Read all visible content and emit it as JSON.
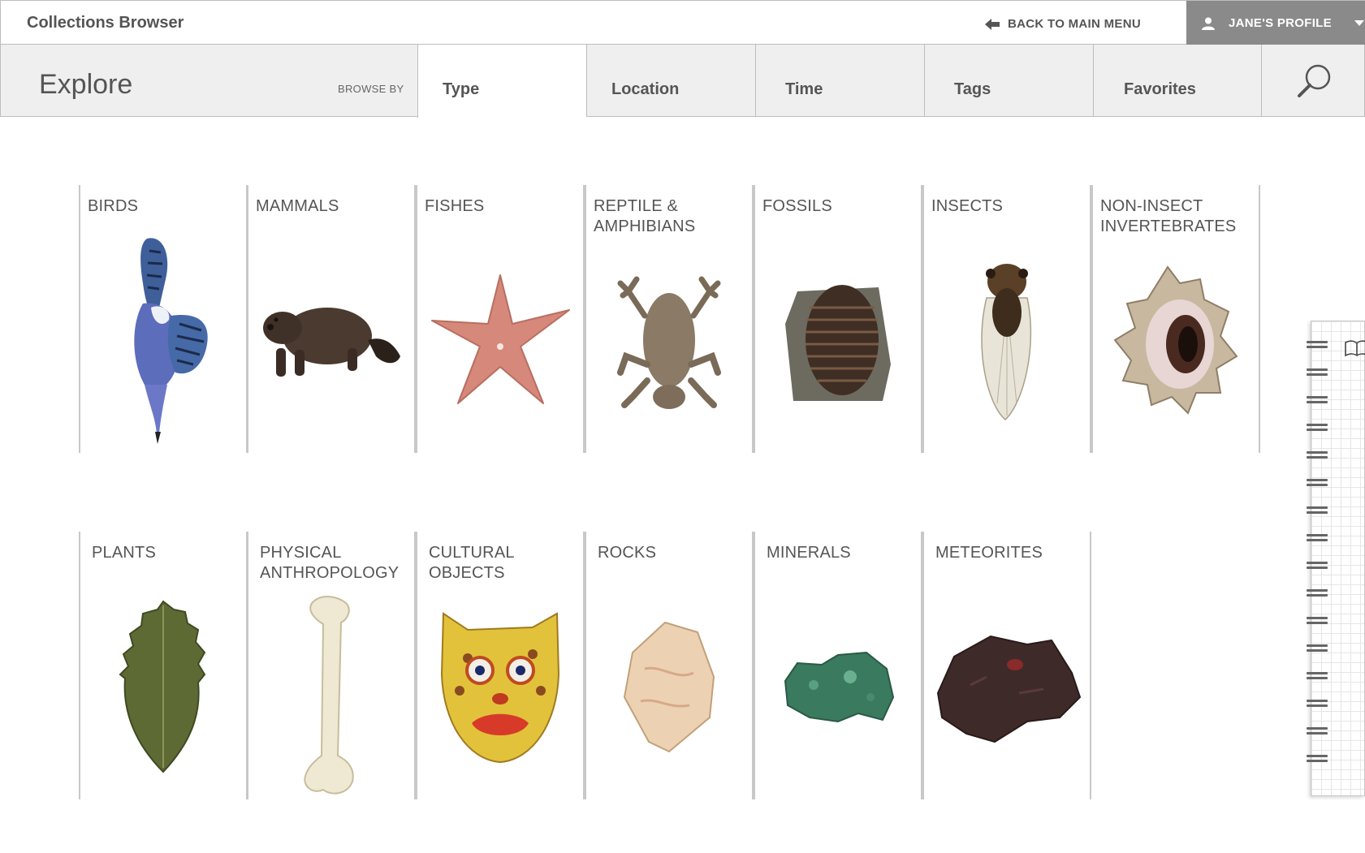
{
  "header": {
    "app_title": "Collections Browser",
    "back_label": "BACK TO MAIN MENU",
    "profile_label": "JANE'S PROFILE"
  },
  "nav": {
    "explore": "Explore",
    "browse_by": "BROWSE BY",
    "tabs": [
      {
        "label": "Type",
        "active": true
      },
      {
        "label": "Location",
        "active": false
      },
      {
        "label": "Time",
        "active": false
      },
      {
        "label": "Tags",
        "active": false
      },
      {
        "label": "Favorites",
        "active": false
      }
    ]
  },
  "categories": [
    {
      "label": "BIRDS",
      "icon": "bird-icon"
    },
    {
      "label": "MAMMALS",
      "icon": "mammal-icon"
    },
    {
      "label": "FISHES",
      "icon": "starfish-icon"
    },
    {
      "label": "REPTILE &\nAMPHIBIANS",
      "icon": "frog-icon"
    },
    {
      "label": "FOSSILS",
      "icon": "trilobite-icon"
    },
    {
      "label": "INSECTS",
      "icon": "cicada-icon"
    },
    {
      "label": "NON-INSECT\nINVERTEBRATES",
      "icon": "shell-icon"
    },
    {
      "label": "PLANTS",
      "icon": "leaf-icon"
    },
    {
      "label": "PHYSICAL\nANTHROPOLOGY",
      "icon": "bone-icon"
    },
    {
      "label": "CULTURAL\nOBJECTS",
      "icon": "mask-icon"
    },
    {
      "label": "ROCKS",
      "icon": "rock-icon"
    },
    {
      "label": "MINERALS",
      "icon": "mineral-icon"
    },
    {
      "label": "METEORITES",
      "icon": "meteorite-icon"
    }
  ],
  "colors": {
    "profile_bg": "#8a8a8a",
    "nav_bg": "#efefef",
    "active_tab_bg": "#ffffff"
  }
}
